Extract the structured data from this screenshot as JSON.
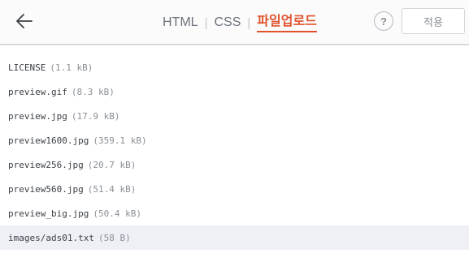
{
  "header": {
    "tabs": [
      {
        "label": "HTML"
      },
      {
        "label": "CSS"
      },
      {
        "label": "파일업로드",
        "active": true
      }
    ],
    "help_label": "?",
    "apply_label": "적용"
  },
  "files": [
    {
      "name": "LICENSE",
      "size": "(1.1 kB)"
    },
    {
      "name": "preview.gif",
      "size": "(8.3 kB)"
    },
    {
      "name": "preview.jpg",
      "size": "(17.9 kB)"
    },
    {
      "name": "preview1600.jpg",
      "size": "(359.1 kB)"
    },
    {
      "name": "preview256.jpg",
      "size": "(20.7 kB)"
    },
    {
      "name": "preview560.jpg",
      "size": "(51.4 kB)"
    },
    {
      "name": "preview_big.jpg",
      "size": "(50.4 kB)"
    },
    {
      "name": "images/ads01.txt",
      "size": "(58 B)",
      "selected": true
    }
  ],
  "colors": {
    "accent": "#e0522c",
    "selected_row": "#eef0f6"
  },
  "icons": {
    "back": "arrow-left-icon",
    "help": "question-icon"
  }
}
